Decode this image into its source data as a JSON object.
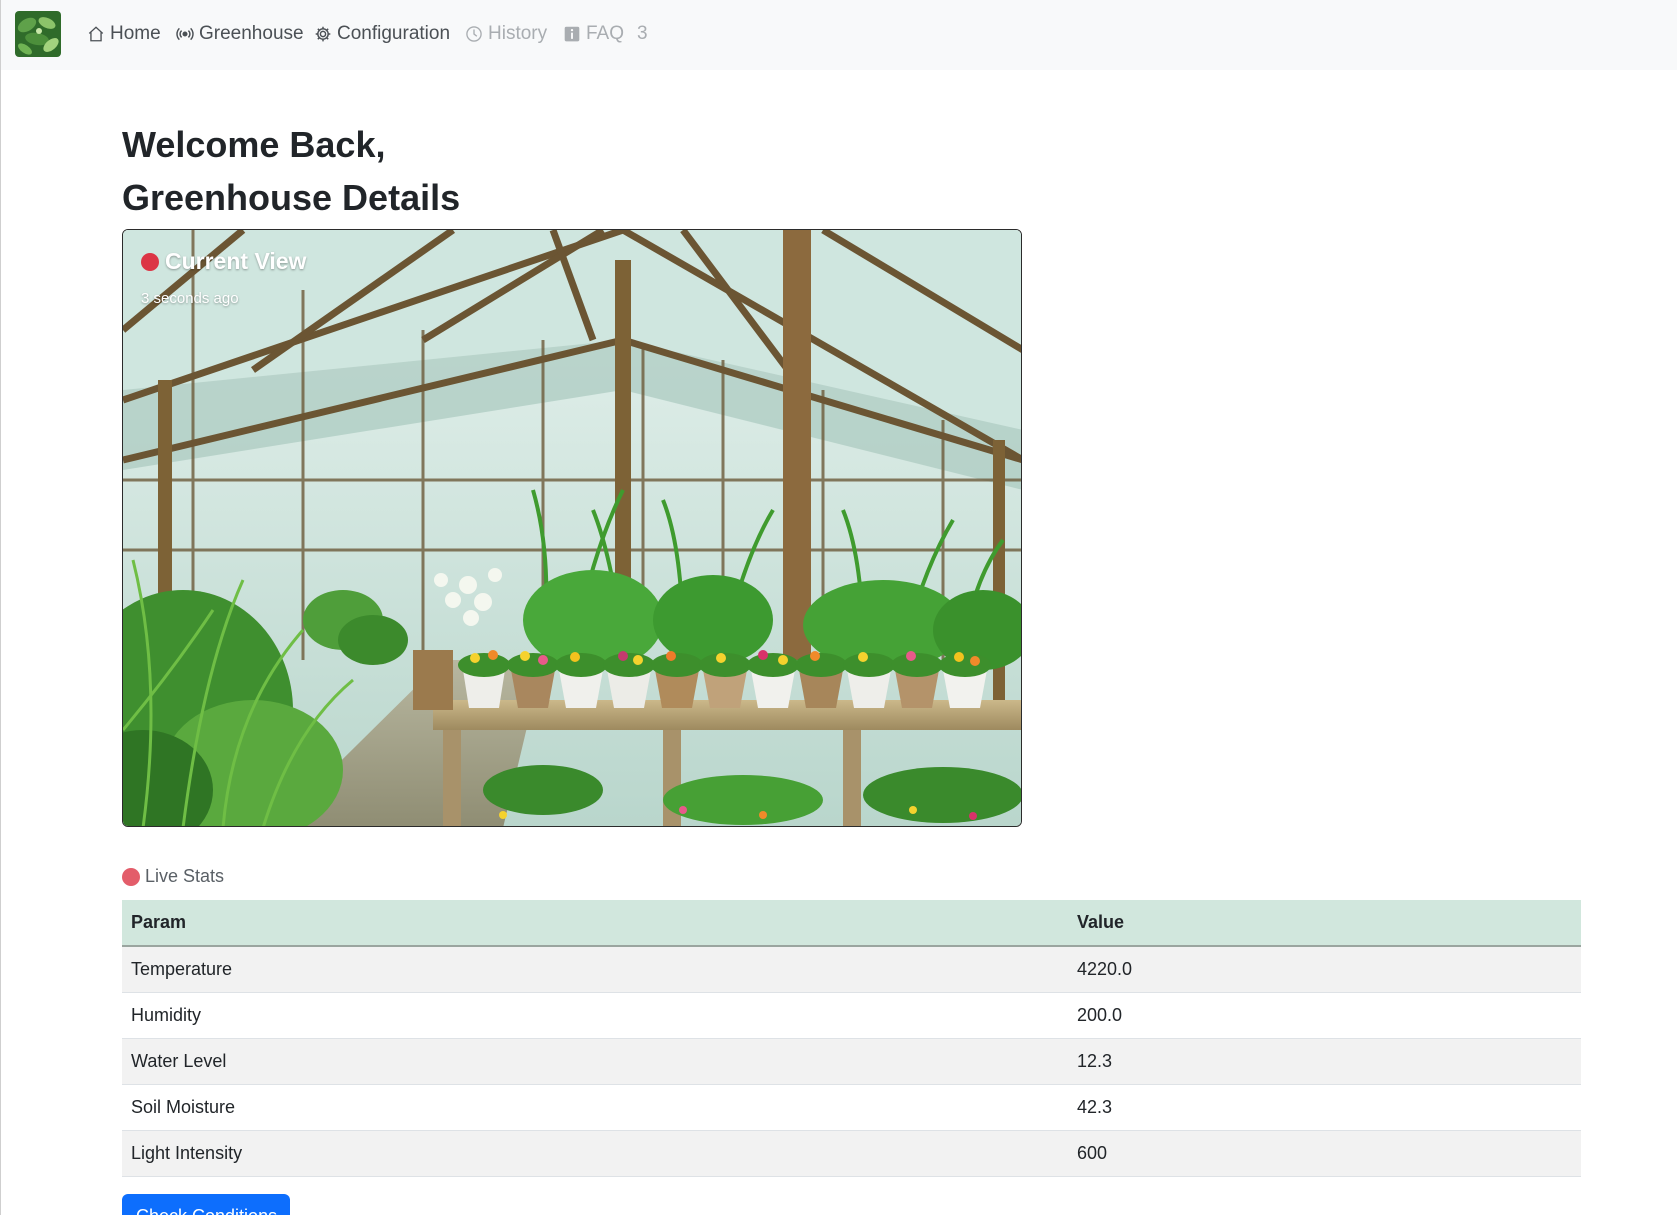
{
  "nav": {
    "items": [
      {
        "label": "Home",
        "icon": "house-icon"
      },
      {
        "label": "Greenhouse",
        "icon": "broadcast-icon"
      },
      {
        "label": "Configuration",
        "icon": "gear-icon"
      },
      {
        "label": "History",
        "icon": "clock-icon"
      },
      {
        "label": "FAQ",
        "icon": "info-square-icon"
      }
    ],
    "count": "3"
  },
  "header": {
    "welcome": "Welcome Back,",
    "title": "Greenhouse Details"
  },
  "camera": {
    "title": "Current View",
    "timestamp": "3 seconds ago"
  },
  "stats": {
    "label": "Live Stats",
    "columns": [
      "Param",
      "Value"
    ],
    "rows": [
      {
        "param": "Temperature",
        "value": "4220.0"
      },
      {
        "param": "Humidity",
        "value": "200.0"
      },
      {
        "param": "Water Level",
        "value": "12.3"
      },
      {
        "param": "Soil Moisture",
        "value": "42.3"
      },
      {
        "param": "Light Intensity",
        "value": "600"
      }
    ]
  },
  "actions": {
    "check_label": "Check Conditions"
  },
  "colors": {
    "navbar_bg": "#f8f9fa",
    "table_header_bg": "#d1e7dd",
    "live_dot": "#e35d6a",
    "primary_button": "#0d6efd"
  }
}
